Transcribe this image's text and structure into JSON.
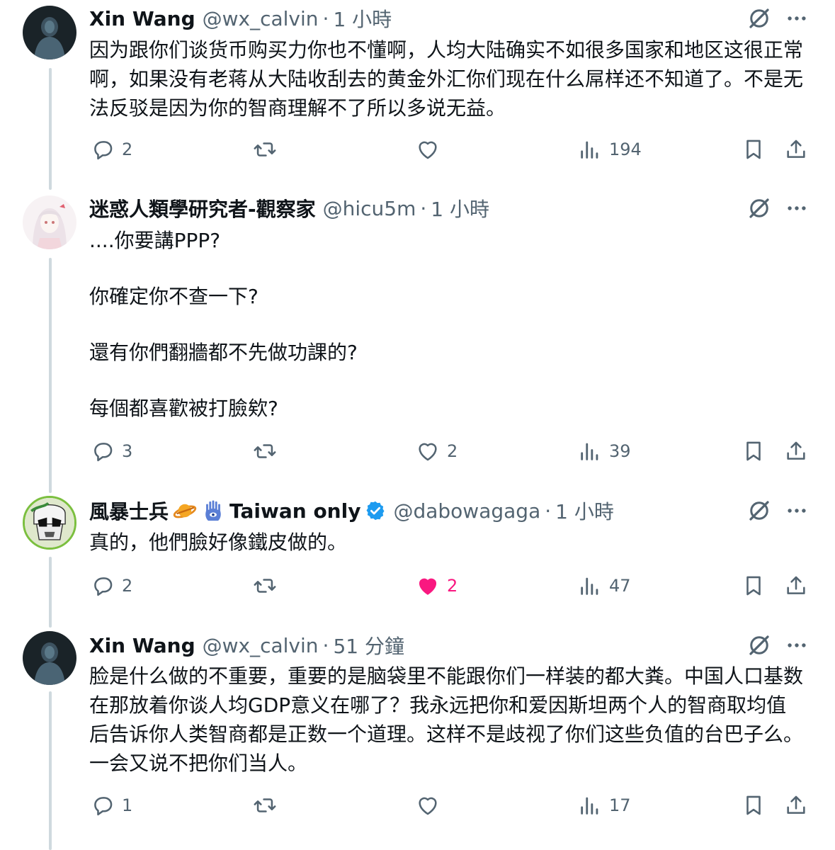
{
  "tweets": [
    {
      "name": "Xin Wang",
      "handle": "@wx_calvin",
      "sep": "·",
      "time": "1 小時",
      "text": [
        "因为跟你们谈货币购买力你也不懂啊，人均大陆确实不如很多国家和地区这很正常啊，如果没有老蒋从大陆收刮去的黄金外汇你们现在什么屌样还不知道了。不是无法反驳是因为你的智商理解不了所以多说无益。"
      ],
      "replies": "2",
      "retweets": "",
      "likes": "",
      "views": "194"
    },
    {
      "name": "迷惑人類學研究者-觀察家",
      "handle": "@hicu5m",
      "sep": "·",
      "time": "1 小時",
      "text": [
        "....你要講PPP?",
        "你確定你不查一下?",
        "還有你們翻牆都不先做功課的?",
        "每個都喜歡被打臉欸?"
      ],
      "replies": "3",
      "retweets": "",
      "likes": "2",
      "views": "39"
    },
    {
      "name": "風暴士兵",
      "name_suffix": "Taiwan only",
      "emoji": [
        "ringed-planet-emoji",
        "hamsa-emoji"
      ],
      "verified": true,
      "handle": "@dabowagaga",
      "sep": "·",
      "time": "1 小時",
      "text": [
        "真的，他們臉好像鐵皮做的。"
      ],
      "replies": "2",
      "retweets": "",
      "likes": "2",
      "liked": true,
      "views": "47"
    },
    {
      "name": "Xin Wang",
      "handle": "@wx_calvin",
      "sep": "·",
      "time": "51 分鐘",
      "text": [
        "脸是什么做的不重要，重要的是脑袋里不能跟你们一样装的都大粪。中国人口基数在那放着你谈人均GDP意义在哪了？我永远把你和爱因斯坦两个人的智商取均值后告诉你人类智商都是正数一个道理。这样不是歧视了你们这些负值的台巴子么。一会又说不把你们当人。"
      ],
      "replies": "1",
      "retweets": "",
      "likes": "",
      "views": "17"
    }
  ],
  "colors": {
    "text": "#0f1419",
    "secondary": "#536471",
    "like_active": "#f91880",
    "verified": "#1d9bf0",
    "thread_line": "#cfd9de"
  },
  "icons": [
    "reply-icon",
    "retweet-icon",
    "like-icon",
    "views-icon",
    "bookmark-icon",
    "share-icon",
    "grok-icon",
    "more-icon"
  ]
}
